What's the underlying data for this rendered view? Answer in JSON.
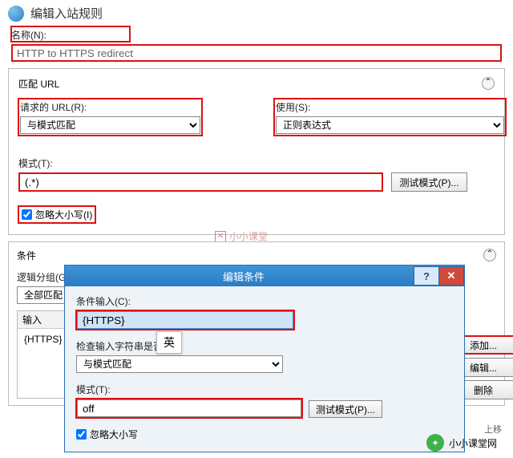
{
  "header": {
    "title": "编辑入站规则"
  },
  "name": {
    "label": "名称(N):",
    "value": "HTTP to HTTPS redirect"
  },
  "matchUrl": {
    "title": "匹配 URL",
    "reqUrl": {
      "label": "请求的 URL(R):",
      "value": "与模式匹配"
    },
    "use": {
      "label": "使用(S):",
      "value": "正则表达式"
    },
    "pattern": {
      "label": "模式(T):",
      "value": "(.*)"
    },
    "testBtn": "测试模式(P)...",
    "ignoreCase": "忽略大小写(I)"
  },
  "conditions": {
    "title": "条件",
    "logicGroup": "逻辑分组(G)",
    "logicValue": "全部匹配",
    "inputHead": "输入",
    "inputVal": "{HTTPS}",
    "buttons": {
      "add": "添加...",
      "edit": "编辑...",
      "delete": "删除"
    }
  },
  "dialog": {
    "title": "编辑条件",
    "condInput": {
      "label": "条件输入(C):",
      "value": "{HTTPS}"
    },
    "check": {
      "label": "检查输入字符串是否(I):",
      "value": "与模式匹配"
    },
    "pattern": {
      "label": "模式(T):",
      "value": "off"
    },
    "testBtn": "测试模式(P)...",
    "ignoreCase": "忽略大小写",
    "ime": "英"
  },
  "watermark": "小小课堂",
  "footerWm": "小小课堂网",
  "upBtn": "上移"
}
